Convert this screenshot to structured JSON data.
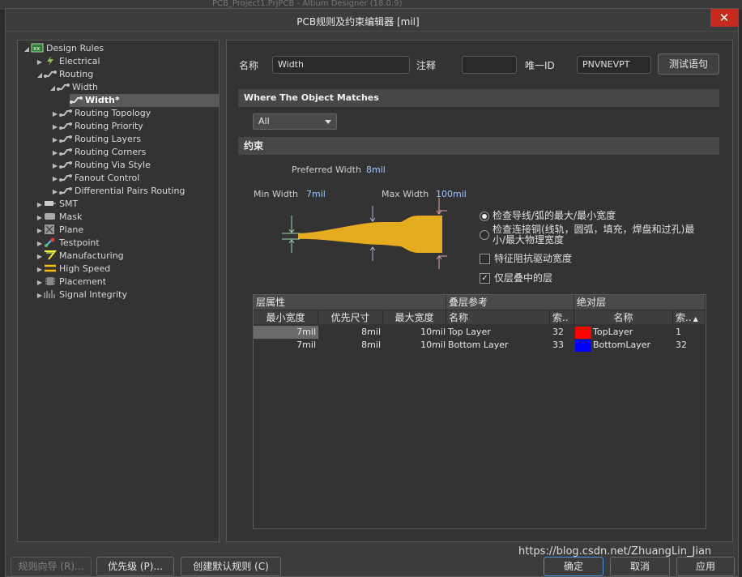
{
  "background_title": "PCB_Project1.PrjPCB - Altium Designer (18.0.9)",
  "window": {
    "title": "PCB规则及约束编辑器 [mil]"
  },
  "tree": {
    "root": "Design Rules",
    "items": [
      {
        "label": "Electrical"
      },
      {
        "label": "Routing"
      },
      {
        "label": "Width"
      },
      {
        "label": "Width*"
      },
      {
        "label": "Routing Topology"
      },
      {
        "label": "Routing Priority"
      },
      {
        "label": "Routing Layers"
      },
      {
        "label": "Routing Corners"
      },
      {
        "label": "Routing Via Style"
      },
      {
        "label": "Fanout Control"
      },
      {
        "label": "Differential Pairs Routing"
      },
      {
        "label": "SMT"
      },
      {
        "label": "Mask"
      },
      {
        "label": "Plane"
      },
      {
        "label": "Testpoint"
      },
      {
        "label": "Manufacturing"
      },
      {
        "label": "High Speed"
      },
      {
        "label": "Placement"
      },
      {
        "label": "Signal Integrity"
      }
    ]
  },
  "header": {
    "name_label": "名称",
    "name_value": "Width",
    "comment_label": "注释",
    "comment_value": "",
    "uid_label": "唯一ID",
    "uid_value": "PNVNEVPT",
    "test_button": "测试语句"
  },
  "where": {
    "title": "Where The Object Matches",
    "dropdown_value": "All"
  },
  "constraints": {
    "title": "约束",
    "preferred_label": "Preferred Width",
    "preferred_value": "8mil",
    "min_label": "Min Width",
    "min_value": "7mil",
    "max_label": "Max Width",
    "max_value": "100mil",
    "options": {
      "radio1": "检查导线/弧的最大/最小宽度",
      "radio2_line1": "检查连接铜(线轨，圆弧，填充，焊盘和过孔)最",
      "radio2_line2": "小/最大物理宽度",
      "check1": "特征阻抗驱动宽度",
      "check2": "仅层叠中的层"
    },
    "colors": {
      "trace": "#e6ac1f",
      "top_layer": "#ff0000",
      "bottom_layer": "#0000ff"
    }
  },
  "grid": {
    "group_headers": [
      "层属性",
      "叠层参考",
      "绝对层"
    ],
    "columns": [
      "最小宽度",
      "优先尺寸",
      "最大宽度",
      "名称",
      "索..",
      "名称",
      "索.."
    ],
    "rows": [
      {
        "min": "7mil",
        "pref": "8mil",
        "max": "10mil",
        "stack_name": "Top Layer",
        "stack_idx": "32",
        "abs_name": "TopLayer",
        "abs_idx": "1"
      },
      {
        "min": "7mil",
        "pref": "8mil",
        "max": "10mil",
        "stack_name": "Bottom Layer",
        "stack_idx": "33",
        "abs_name": "BottomLayer",
        "abs_idx": "32"
      }
    ]
  },
  "footer": {
    "wizard": "规则向导 (R)...",
    "priority": "优先级 (P)...",
    "create_default": "创建默认规则 (C)",
    "ok": "确定",
    "cancel": "取消",
    "apply": "应用",
    "watermark": "https://blog.csdn.net/ZhuangLin_Jian"
  }
}
